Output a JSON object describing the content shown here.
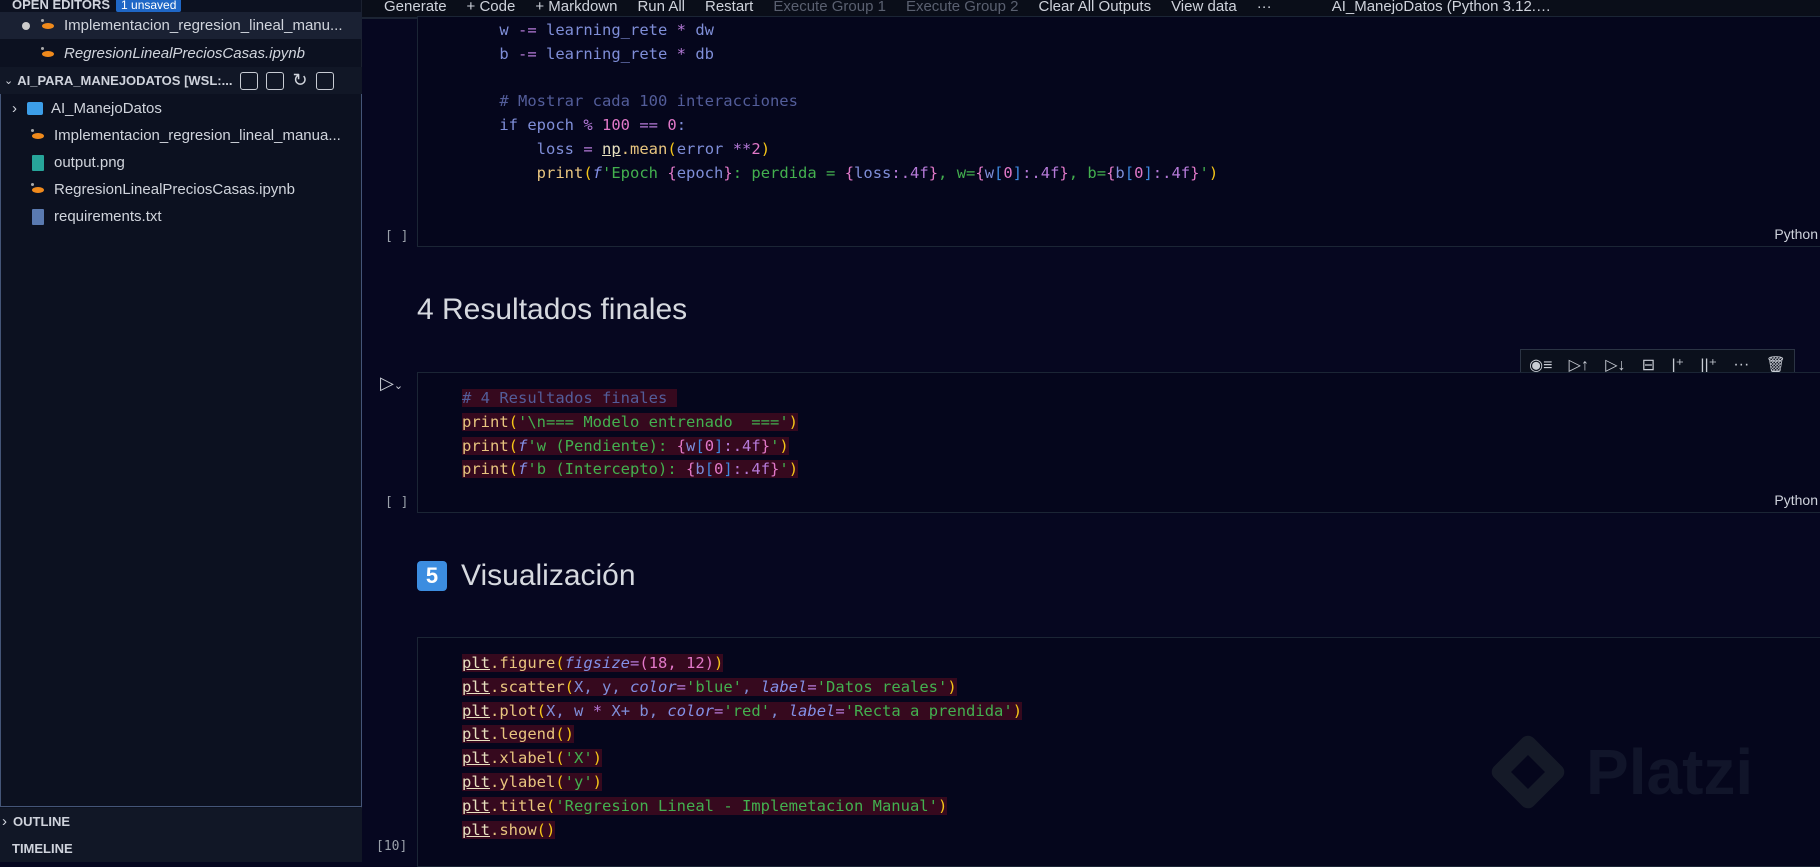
{
  "sidebar": {
    "open_editors": {
      "title": "OPEN EDITORS",
      "badge": "1 unsaved",
      "items": [
        {
          "label": "Implementacion_regresion_lineal_manu...",
          "modified": true
        },
        {
          "label": "RegresionLinealPreciosCasas.ipynb",
          "modified": false
        }
      ]
    },
    "workspace": {
      "title": "AI_PARA_MANEJODATOS [WSL:...",
      "items": [
        {
          "label": "AI_ManejoDatos",
          "icon": "folder-icon"
        },
        {
          "label": "Implementacion_regresion_lineal_manua...",
          "icon": "notebook-icon"
        },
        {
          "label": "output.png",
          "icon": "image-file-icon"
        },
        {
          "label": "RegresionLinealPreciosCasas.ipynb",
          "icon": "notebook-icon"
        },
        {
          "label": "requirements.txt",
          "icon": "text-file-icon"
        }
      ]
    },
    "outline": "OUTLINE",
    "timeline": "TIMELINE"
  },
  "toolbar": {
    "generate": "Generate",
    "code": "+ Code",
    "markdown": "+ Markdown",
    "run_all": "Run All",
    "restart": "Restart",
    "exec1": "Execute Group 1",
    "exec2": "Execute Group 2",
    "clear": "Clear All Outputs",
    "view_data": "View data",
    "more": "···",
    "kernel": "AI_ManejoDatos (Python 3.12.…"
  },
  "cells": {
    "c1": {
      "bracket": "[ ]",
      "lang": "Python",
      "lines": [
        [
          [
            "    w ",
            "def"
          ],
          [
            "-=",
            "op"
          ],
          [
            " learning_rete ",
            "def"
          ],
          [
            "*",
            "op"
          ],
          [
            " dw",
            "def"
          ]
        ],
        [
          [
            "    b ",
            "def"
          ],
          [
            "-=",
            "op"
          ],
          [
            " learning_rete ",
            "def"
          ],
          [
            "*",
            "op"
          ],
          [
            " db",
            "def"
          ]
        ],
        [],
        [
          [
            "    # Mostrar cada 100 interacciones",
            "com"
          ]
        ],
        [
          [
            "    if ",
            "def"
          ],
          [
            "epoch ",
            "def"
          ],
          [
            "%",
            "op"
          ],
          [
            " 100 ",
            "num"
          ],
          [
            "==",
            "op"
          ],
          [
            " 0",
            "num"
          ],
          [
            ":",
            "def"
          ]
        ],
        [
          [
            "        loss ",
            "def"
          ],
          [
            "=",
            "op"
          ],
          [
            " ",
            "def"
          ],
          [
            "np",
            "mod"
          ],
          [
            ".mean",
            "fn"
          ],
          [
            "(",
            "par"
          ],
          [
            "error ",
            "def"
          ],
          [
            "**",
            "op"
          ],
          [
            "2",
            "num"
          ],
          [
            ")",
            "par"
          ]
        ],
        [
          [
            "        print",
            "fn"
          ],
          [
            "(",
            "par"
          ],
          [
            "f",
            "kw"
          ],
          [
            "'Epoch ",
            "str"
          ],
          [
            "{",
            "num"
          ],
          [
            "epoch",
            "def"
          ],
          [
            "}",
            "num"
          ],
          [
            ": perdida = ",
            "str"
          ],
          [
            "{",
            "num"
          ],
          [
            "loss",
            "def"
          ],
          [
            ":.4f",
            "op"
          ],
          [
            "}",
            "num"
          ],
          [
            ", w=",
            "str"
          ],
          [
            "{",
            "num"
          ],
          [
            "w",
            "def"
          ],
          [
            "[",
            "br"
          ],
          [
            "0",
            "num"
          ],
          [
            "]",
            "br"
          ],
          [
            ":.4f",
            "op"
          ],
          [
            "}",
            "num"
          ],
          [
            ", b=",
            "str"
          ],
          [
            "{",
            "num"
          ],
          [
            "b",
            "def"
          ],
          [
            "[",
            "br"
          ],
          [
            "0",
            "num"
          ],
          [
            "]",
            "br"
          ],
          [
            ":.4f",
            "op"
          ],
          [
            "}",
            "num"
          ],
          [
            "'",
            "str"
          ],
          [
            ")",
            "par"
          ]
        ]
      ]
    },
    "h4": "4 Resultados finales",
    "c2": {
      "bracket": "[ ]",
      "lang": "Python",
      "lines": [
        [
          [
            "# 4 Resultados finales ",
            "com"
          ]
        ],
        [
          [
            "print",
            "fn"
          ],
          [
            "(",
            "par"
          ],
          [
            "'\\n=== Modelo entrenado  ===",
            "str"
          ],
          [
            "'",
            "str"
          ],
          [
            ")",
            "par"
          ]
        ],
        [
          [
            "print",
            "fn"
          ],
          [
            "(",
            "par"
          ],
          [
            "f",
            "kw"
          ],
          [
            "'w (Pendiente): ",
            "str"
          ],
          [
            "{",
            "num"
          ],
          [
            "w",
            "def"
          ],
          [
            "[",
            "br"
          ],
          [
            "0",
            "num"
          ],
          [
            "]",
            "br"
          ],
          [
            ":.4f",
            "op"
          ],
          [
            "}",
            "num"
          ],
          [
            "'",
            "str"
          ],
          [
            ")",
            "par"
          ]
        ],
        [
          [
            "print",
            "fn"
          ],
          [
            "(",
            "par"
          ],
          [
            "f",
            "kw"
          ],
          [
            "'b (Intercepto): ",
            "str"
          ],
          [
            "{",
            "num"
          ],
          [
            "b",
            "def"
          ],
          [
            "[",
            "br"
          ],
          [
            "0",
            "num"
          ],
          [
            "]",
            "br"
          ],
          [
            ":.4f",
            "op"
          ],
          [
            "}",
            "num"
          ],
          [
            "'",
            "str"
          ],
          [
            ")",
            "par"
          ]
        ]
      ]
    },
    "h5_num": "5",
    "h5": "Visualización",
    "c3": {
      "bracket": "[10]",
      "lines": [
        [
          [
            "plt",
            "mod"
          ],
          [
            ".figure",
            "fn"
          ],
          [
            "(",
            "par"
          ],
          [
            "figsize",
            "kw"
          ],
          [
            "=",
            "op"
          ],
          [
            "(",
            "num"
          ],
          [
            "18, 12",
            "num"
          ],
          [
            ")",
            "num"
          ],
          [
            ")",
            "par"
          ]
        ],
        [
          [
            "plt",
            "mod"
          ],
          [
            ".scatter",
            "fn"
          ],
          [
            "(",
            "par"
          ],
          [
            "X, y, ",
            "def"
          ],
          [
            "color",
            "kw"
          ],
          [
            "=",
            "op"
          ],
          [
            "'blue'",
            "str"
          ],
          [
            ", ",
            "def"
          ],
          [
            "label",
            "kw"
          ],
          [
            "=",
            "op"
          ],
          [
            "'Datos reales'",
            "str"
          ],
          [
            ")",
            "par"
          ]
        ],
        [
          [
            "plt",
            "mod"
          ],
          [
            ".plot",
            "fn"
          ],
          [
            "(",
            "par"
          ],
          [
            "X, w ",
            "def"
          ],
          [
            "*",
            "op"
          ],
          [
            " X+ b, ",
            "def"
          ],
          [
            "color",
            "kw"
          ],
          [
            "=",
            "op"
          ],
          [
            "'red'",
            "str"
          ],
          [
            ", ",
            "def"
          ],
          [
            "label",
            "kw"
          ],
          [
            "=",
            "op"
          ],
          [
            "'Recta a prendida'",
            "str"
          ],
          [
            ")",
            "par"
          ]
        ],
        [
          [
            "plt",
            "mod"
          ],
          [
            ".legend",
            "fn"
          ],
          [
            "()",
            "par"
          ]
        ],
        [
          [
            "plt",
            "mod"
          ],
          [
            ".xlabel",
            "fn"
          ],
          [
            "(",
            "par"
          ],
          [
            "'X'",
            "str"
          ],
          [
            ")",
            "par"
          ]
        ],
        [
          [
            "plt",
            "mod"
          ],
          [
            ".ylabel",
            "fn"
          ],
          [
            "(",
            "par"
          ],
          [
            "'y'",
            "str"
          ],
          [
            ")",
            "par"
          ]
        ],
        [
          [
            "plt",
            "mod"
          ],
          [
            ".title",
            "fn"
          ],
          [
            "(",
            "par"
          ],
          [
            "'Regresion Lineal - Implemetacion Manual'",
            "str"
          ],
          [
            ")",
            "par"
          ]
        ],
        [
          [
            "plt",
            "mod"
          ],
          [
            ".show",
            "fn"
          ],
          [
            "()",
            "par"
          ]
        ]
      ]
    }
  },
  "watermark": "Platzi"
}
